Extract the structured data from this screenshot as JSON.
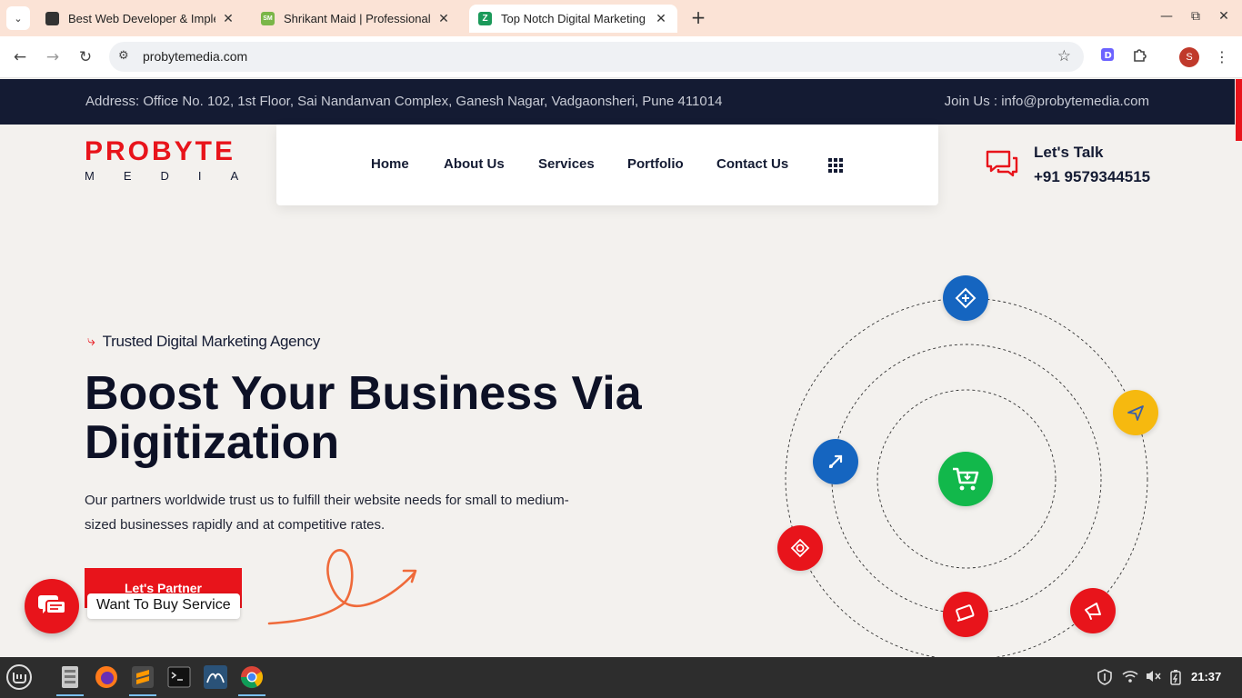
{
  "browser": {
    "tabs": [
      {
        "title": "Best Web Developer & Imple",
        "favicon": "dark-favicon",
        "active": false
      },
      {
        "title": "Shrikant Maid | Professional",
        "favicon": "sm-favicon",
        "active": false
      },
      {
        "title": "Top Notch Digital Marketing",
        "favicon": "z-favicon",
        "active": true
      }
    ],
    "favicon_letter": "Z",
    "url": "probytemedia.com",
    "profile_initial": "S"
  },
  "site": {
    "topbar": {
      "address": "Address: Office No. 102, 1st Floor, Sai Nandanvan Complex, Ganesh Nagar, Vadgaonsheri, Pune 411014",
      "join": "Join Us : info@probytemedia.com"
    },
    "logo": {
      "line1": "PROBYTE",
      "line2": "MEDIA"
    },
    "nav": [
      "Home",
      "About Us",
      "Services",
      "Portfolio",
      "Contact Us"
    ],
    "talk": {
      "label": "Let's Talk",
      "phone": "+91 9579344515"
    },
    "hero": {
      "tagline": "Trusted Digital Marketing Agency",
      "title_line1": "Boost Your Business Via",
      "title_line2": "Digitization",
      "description": "Our partners worldwide trust us to fulfill their website needs for small to medium-sized businesses rapidly and at competitive rates.",
      "cta": "Let's Partner"
    },
    "chat": {
      "label": "Want To Buy Service"
    },
    "colors": {
      "brand_red": "#e8141b",
      "navy": "#141b33",
      "blue": "#1565c0",
      "yellow": "#f6b90f",
      "green": "#12b84b"
    }
  },
  "taskbar": {
    "apps": [
      "mint-menu",
      "file-manager",
      "firefox",
      "sublime-text",
      "terminal",
      "mysql-workbench",
      "chrome"
    ],
    "clock": "21:37"
  }
}
